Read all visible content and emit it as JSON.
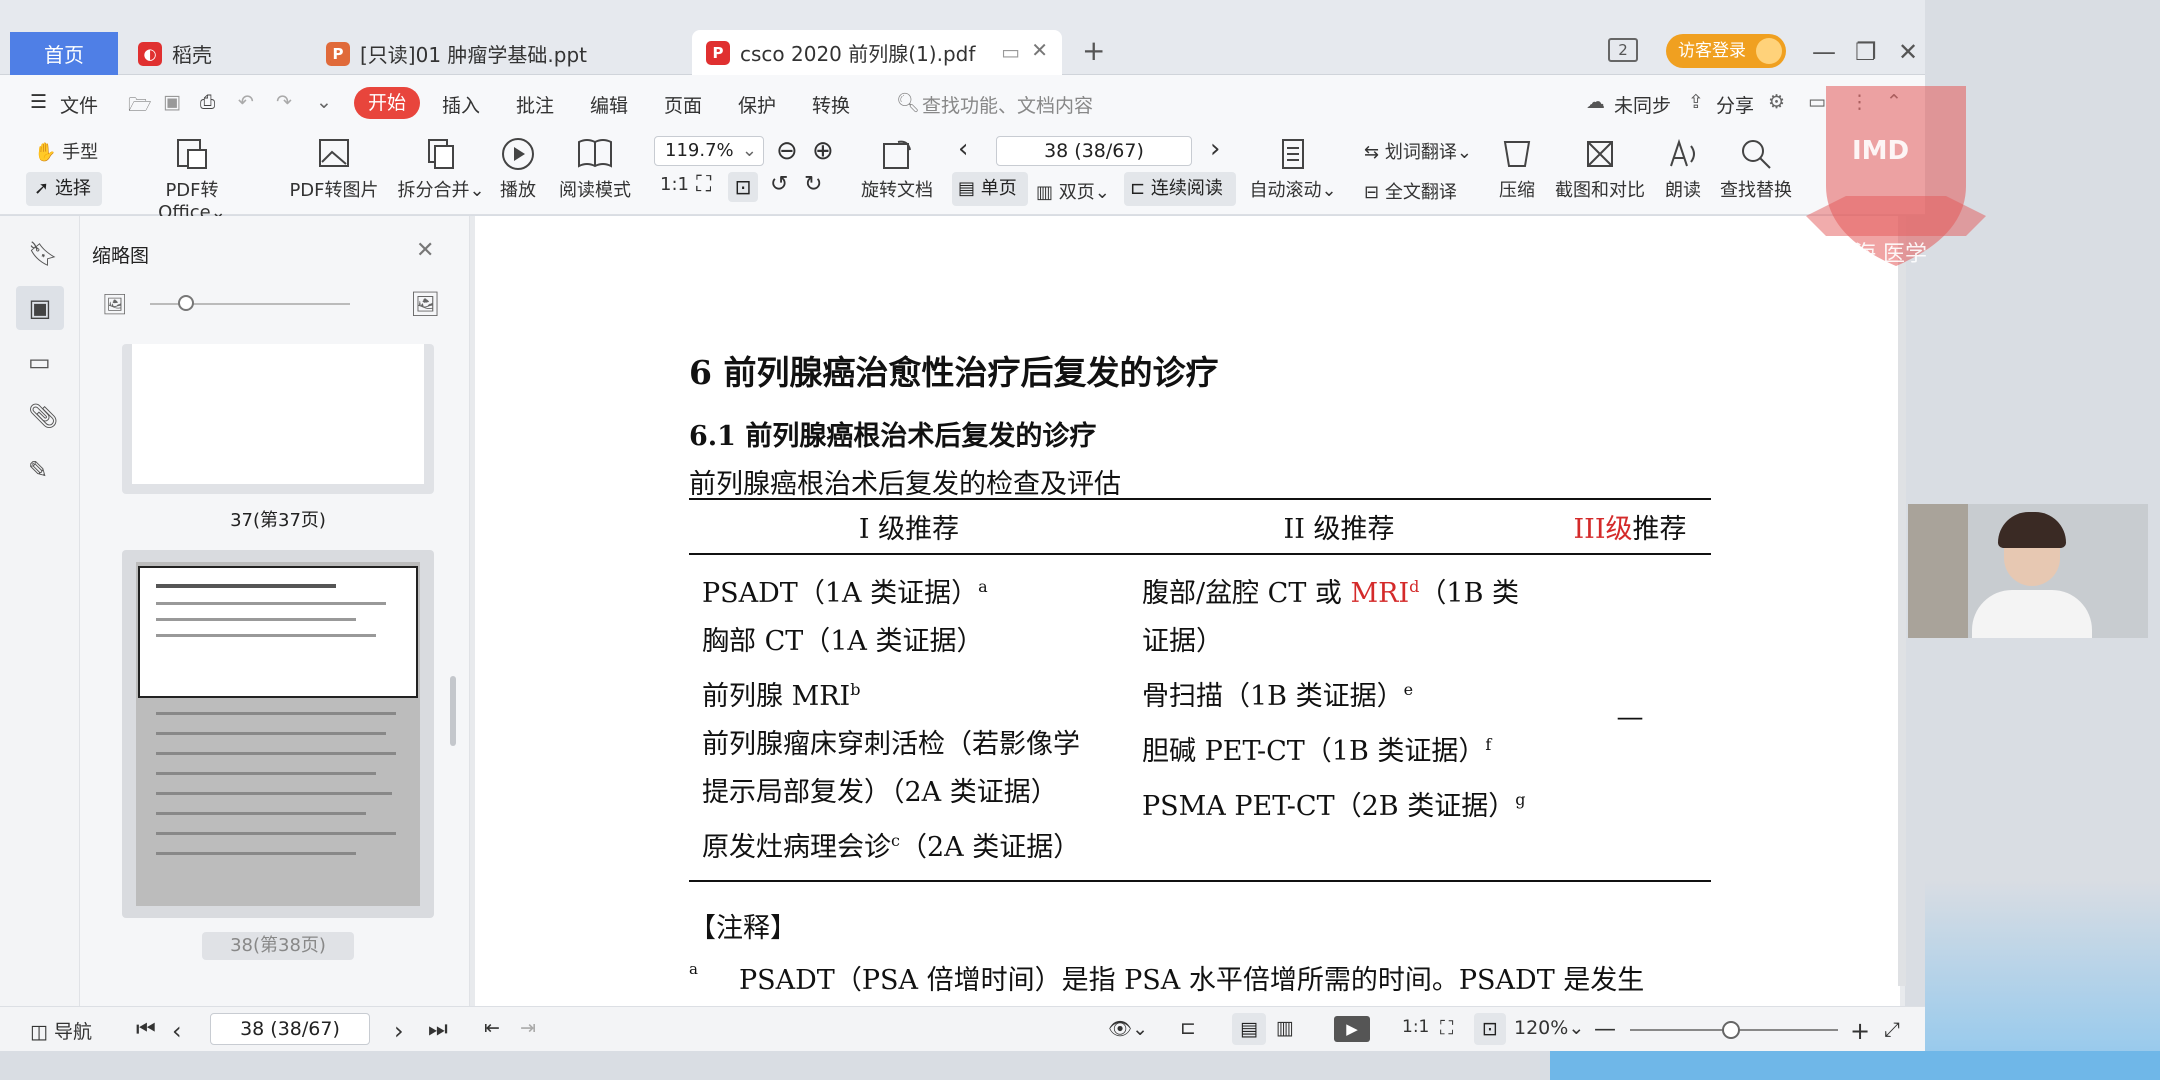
{
  "tabs": {
    "home": "首页",
    "daoke": "稻壳",
    "ppt": "[只读]01 肿瘤学基础.ppt",
    "pdf": "csco 2020 前列腺(1).pdf",
    "new_tab": "+",
    "badge": "2",
    "login": "访客登录"
  },
  "menu": {
    "file": "文件",
    "start": "开始",
    "insert": "插入",
    "annotate": "批注",
    "edit": "编辑",
    "page": "页面",
    "protect": "保护",
    "convert": "转换",
    "search_placeholder": "查找功能、文档内容",
    "sync": "未同步",
    "share": "分享"
  },
  "toolbar": {
    "hand": "手型",
    "select": "选择",
    "pdf_office": "PDF转Office",
    "pdf_image": "PDF转图片",
    "split_merge": "拆分合并",
    "play": "播放",
    "read_mode": "阅读模式",
    "zoom": "119.7%",
    "page_nav": "38 (38/67)",
    "rotate": "旋转文档",
    "single": "单页",
    "double": "双页",
    "continuous": "连续阅读",
    "auto_scroll": "自动滚动",
    "word_translate": "划词翻译",
    "full_translate": "全文翻译",
    "compress": "压缩",
    "screenshot": "截图和对比",
    "read_aloud": "朗读",
    "find_replace": "查找替换"
  },
  "watermark": {
    "text": "IMD",
    "sub": "海 医学"
  },
  "thumbnails": {
    "title": "缩略图",
    "page37": "37(第37页)",
    "page38": "38(第38页)"
  },
  "document": {
    "heading": "6    前列腺癌治愈性治疗后复发的诊疗",
    "subheading": "6.1    前列腺癌根治术后复发的诊疗",
    "table_caption": "前列腺癌根治术后复发的检查及评估",
    "col1_header": "I 级推荐",
    "col2_header": "II 级推荐",
    "col3_header_red": "III级",
    "col3_header_rest": "推荐",
    "col1": [
      {
        "text": "PSADT（1A 类证据）",
        "sup": "a"
      },
      {
        "text": "胸部 CT（1A 类证据）",
        "sup": ""
      },
      {
        "text": "前列腺 MRI",
        "sup": "b"
      },
      {
        "text": "前列腺瘤床穿刺活检（若影像学",
        "sup": ""
      },
      {
        "text": "提示局部复发）（2A 类证据）",
        "sup": ""
      },
      {
        "text": "原发灶病理会诊",
        "sup": "c",
        "after": "（2A 类证据）"
      }
    ],
    "col2": [
      {
        "pre": "腹部/盆腔 CT 或 ",
        "red": "MRI",
        "sup": "d",
        "text": "（1B 类"
      },
      {
        "text": "证据）"
      },
      {
        "text": "骨扫描（1B 类证据）",
        "sup": "e"
      },
      {
        "text": "胆碱 PET-CT（1B 类证据）",
        "sup": "f"
      },
      {
        "text": "PSMA PET-CT（2B 类证据）",
        "sup": "g"
      }
    ],
    "col3": "—",
    "notes_title": "【注释】",
    "note_a_marker": "a",
    "note_a": "PSADT（PSA 倍增时间）是指 PSA 水平倍增所需的时间。PSADT 是发生"
  },
  "statusbar": {
    "nav": "导航",
    "page": "38 (38/67)",
    "zoom": "120%"
  },
  "colors": {
    "accent": "#4f7fe6",
    "start_button": "#e8453c",
    "red_text": "#d42a2a",
    "login": "#f0a020"
  }
}
